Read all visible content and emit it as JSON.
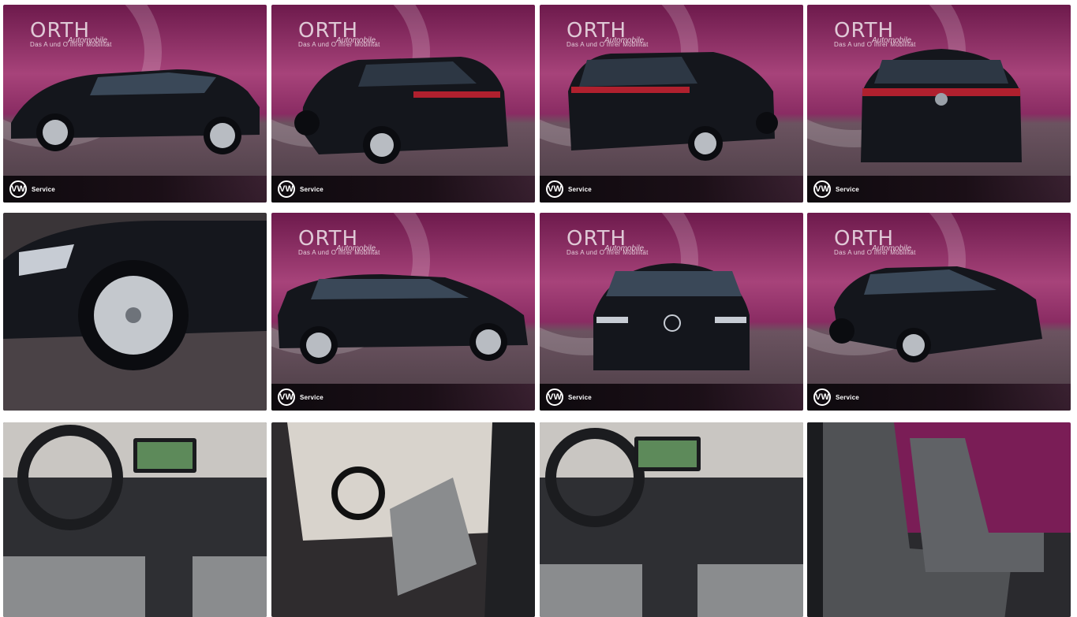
{
  "gallery": {
    "dealer_name": "ORTH",
    "dealer_sub": "Automobile",
    "dealer_tagline": "Das A und O Ihrer Mobilität",
    "brand_badge": "VW",
    "service_label": "Service",
    "colors": {
      "car": "#14161c",
      "studio_top": "#7a1d56",
      "studio_floor": "#5a4550",
      "interior": "#2e2f33",
      "seat": "#8a8c8e"
    },
    "tiles": [
      {
        "id": "side-left",
        "scene": "studio",
        "view": "side-left"
      },
      {
        "id": "rear-left",
        "scene": "studio",
        "view": "rear-quarter-left"
      },
      {
        "id": "rear-right",
        "scene": "studio",
        "view": "rear-quarter-right"
      },
      {
        "id": "rear",
        "scene": "studio",
        "view": "rear"
      },
      {
        "id": "wheel-detail",
        "scene": "detail",
        "view": "wheel"
      },
      {
        "id": "side-right",
        "scene": "studio",
        "view": "side-right"
      },
      {
        "id": "front",
        "scene": "studio",
        "view": "front"
      },
      {
        "id": "front-right",
        "scene": "studio",
        "view": "front-quarter-right"
      },
      {
        "id": "cockpit",
        "scene": "interior",
        "view": "cockpit"
      },
      {
        "id": "driver-door",
        "scene": "interior",
        "view": "door-open"
      },
      {
        "id": "cockpit-2",
        "scene": "interior",
        "view": "cockpit"
      },
      {
        "id": "seats",
        "scene": "interior",
        "view": "seats"
      }
    ]
  }
}
